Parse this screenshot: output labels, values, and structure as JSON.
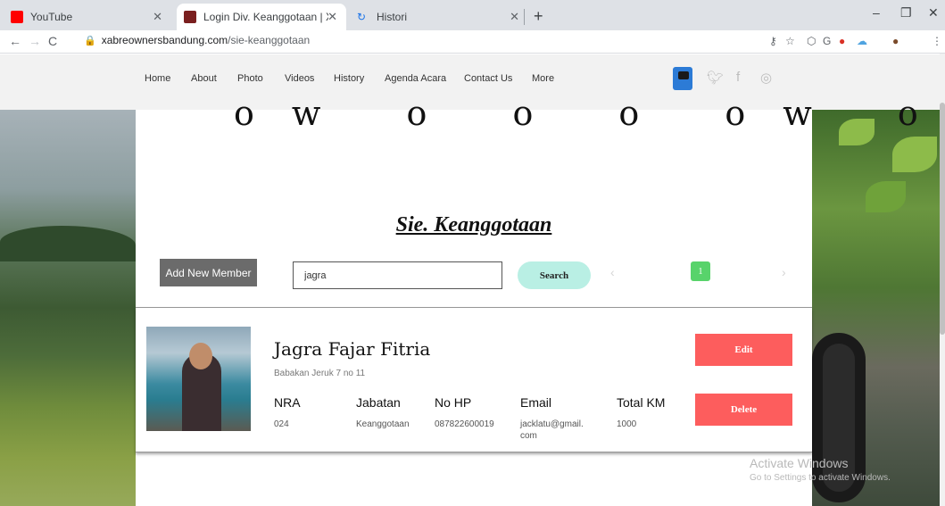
{
  "browser": {
    "tabs": [
      {
        "title": "YouTube",
        "active": false,
        "favicon": "youtube-icon"
      },
      {
        "title": "Login Div. Keanggotaan | Xabre",
        "active": true,
        "favicon": "site-icon"
      },
      {
        "title": "Histori",
        "active": false,
        "favicon": "history-icon"
      }
    ],
    "url_host": "xabreownersbandung.com",
    "url_path": "/sie-keanggotaan"
  },
  "nav": {
    "items": [
      "Home",
      "About",
      "Photo",
      "Videos",
      "History",
      "Agenda Acara",
      "Contact Us",
      "More"
    ]
  },
  "page": {
    "big_text": "ow o o o ow o o o g",
    "section_title": "Sie. Keanggotaan",
    "add_label": "Add New Member",
    "search_value": "jagra",
    "search_label": "Search",
    "pagination": {
      "prev": "‹",
      "current": "1",
      "next": "›"
    }
  },
  "member": {
    "name": "Jagra Fajar Fitria",
    "address": "Babakan Jeruk 7 no 11",
    "headers": {
      "nra": "NRA",
      "jabatan": "Jabatan",
      "nohp": "No HP",
      "email": "Email",
      "totalkm": "Total KM"
    },
    "values": {
      "nra": "024",
      "jabatan": "Keanggotaan",
      "nohp": "087822600019",
      "email": "jacklatu@gmail.\ncom",
      "totalkm": "1000"
    },
    "edit_label": "Edit",
    "delete_label": "Delete"
  },
  "watermark": {
    "title": "Activate Windows",
    "sub": "Go to Settings to activate Windows."
  },
  "colors": {
    "accent_red": "#fd5d5d",
    "search_mint": "#b9efe4",
    "page_green": "#58d36b"
  }
}
